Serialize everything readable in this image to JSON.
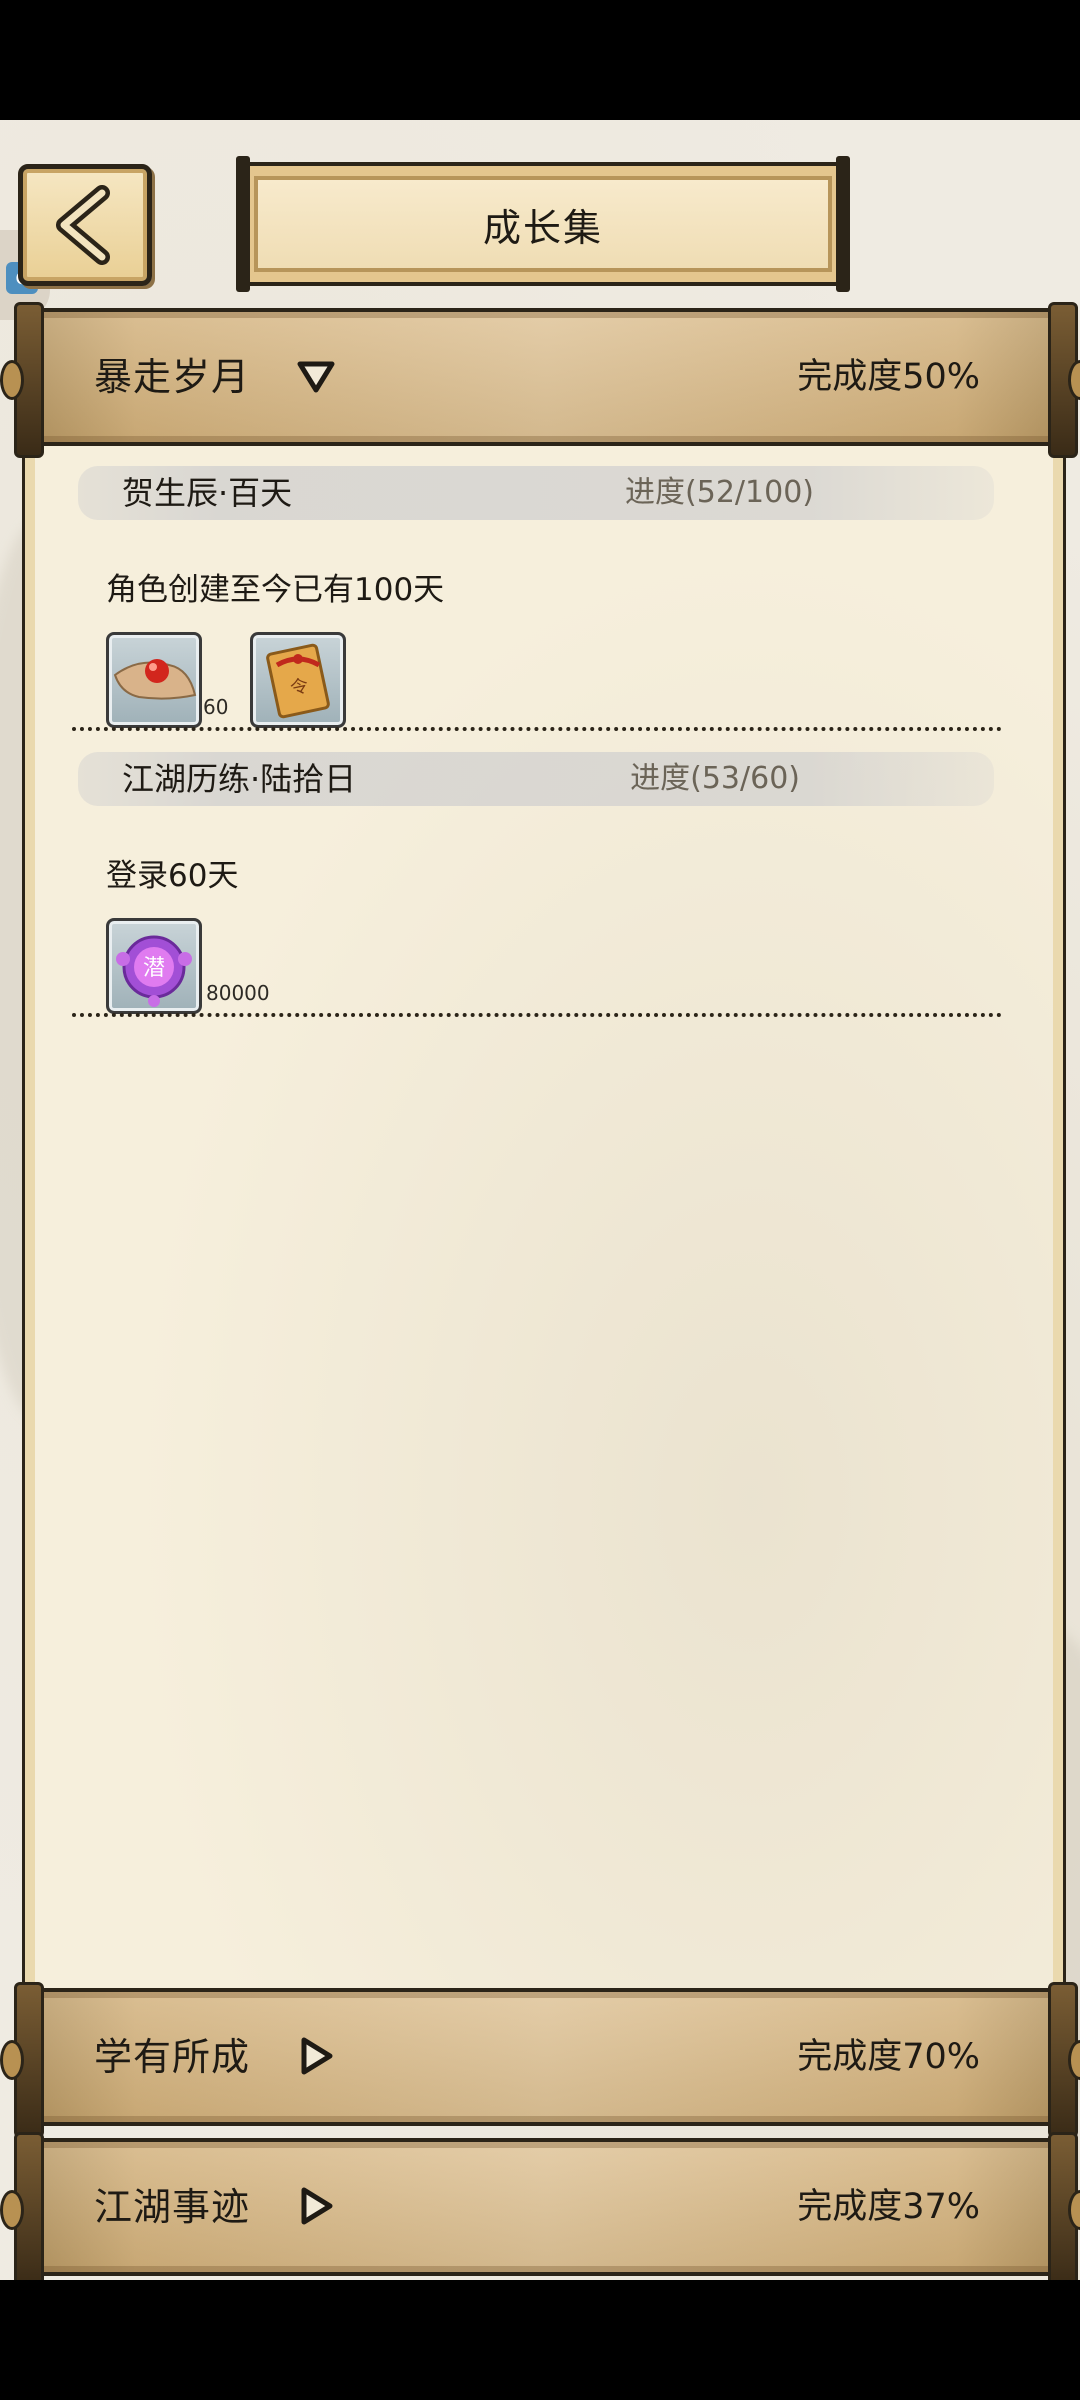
{
  "header": {
    "title": "成长集"
  },
  "categories": [
    {
      "title": "暴走岁月",
      "completion": "完成度50%",
      "expanded": true,
      "entries": [
        {
          "name": "贺生辰·百天",
          "progress": "进度(52/100)",
          "description": "角色创建至今已有100天",
          "rewards": [
            {
              "icon": "red-pill-on-cloth-icon",
              "qty": "60"
            },
            {
              "icon": "red-envelope-scroll-icon",
              "qty": ""
            }
          ]
        },
        {
          "name": "江湖历练·陆拾日",
          "progress": "进度(53/60)",
          "description": "登录60天",
          "rewards": [
            {
              "icon": "purple-potential-orb-icon",
              "qty": "80000",
              "glyph": "潜"
            }
          ]
        }
      ]
    },
    {
      "title": "学有所成",
      "completion": "完成度70%",
      "expanded": false
    },
    {
      "title": "江湖事迹",
      "completion": "完成度37%",
      "expanded": false
    }
  ],
  "colors": {
    "parchment": "#f6efdc",
    "bar_wood": "#d2b07a",
    "ink": "#2b2418"
  }
}
